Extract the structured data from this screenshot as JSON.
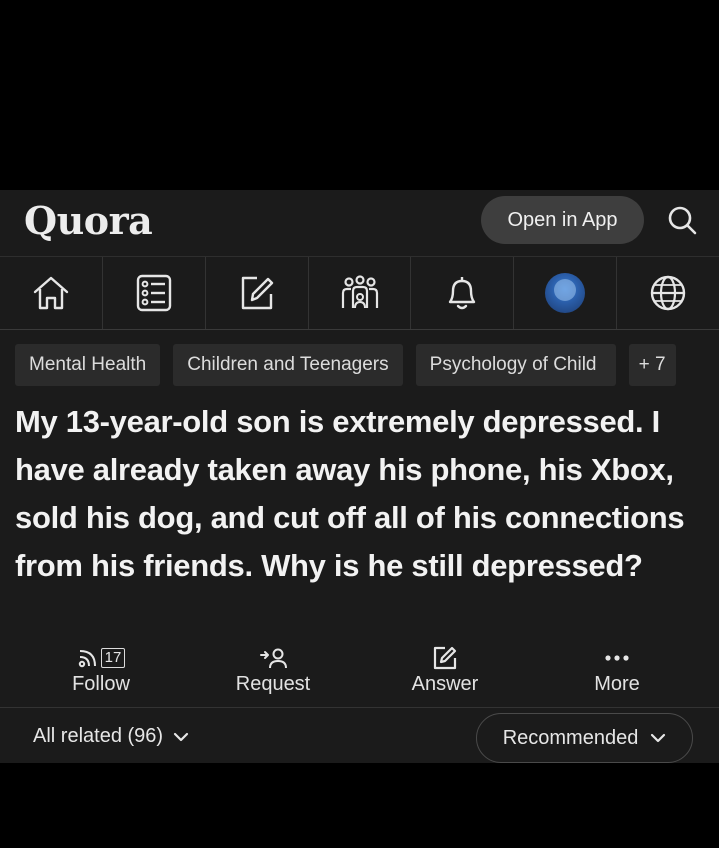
{
  "header": {
    "logo": "Quora",
    "open_in_app": "Open in App"
  },
  "nav": {
    "items": [
      {
        "icon": "home-icon"
      },
      {
        "icon": "feed-list-icon"
      },
      {
        "icon": "write-answer-icon"
      },
      {
        "icon": "spaces-icon"
      },
      {
        "icon": "bell-icon"
      },
      {
        "icon": "avatar"
      },
      {
        "icon": "globe-icon"
      }
    ]
  },
  "topics": [
    "Mental Health",
    "Children and Teenagers",
    "Psychology of Child",
    "+ 7"
  ],
  "question": "My 13-year-old son is extremely depressed. I have already taken away his phone, his Xbox, sold his dog, and cut off all of his connections from his friends. Why is he still depressed?",
  "actions": {
    "follow": {
      "label": "Follow",
      "count": "17"
    },
    "request": {
      "label": "Request"
    },
    "answer": {
      "label": "Answer"
    },
    "more": {
      "label": "More"
    }
  },
  "footer": {
    "all_related": "All related (96)",
    "sort": "Recommended"
  },
  "colors": {
    "background": "#1b1b1b",
    "chip": "#2b2b2b",
    "button": "#3e3e3e",
    "text": "#e6e6e6"
  }
}
